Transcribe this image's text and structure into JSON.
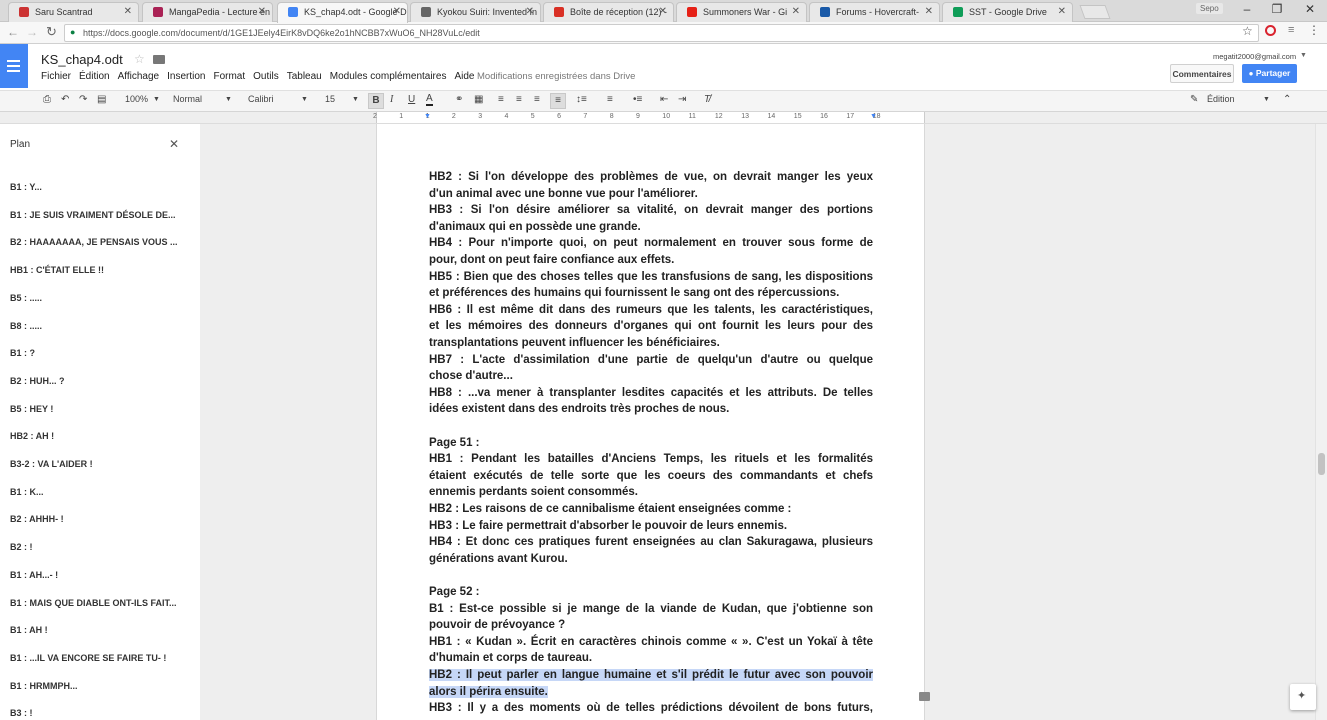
{
  "browser": {
    "tabs": [
      {
        "label": "Saru Scantrad",
        "color": "#cc3333",
        "active": false
      },
      {
        "label": "MangaPedia - Lecture en",
        "color": "#aa2255",
        "active": false
      },
      {
        "label": "KS_chap4.odt - Google D",
        "color": "#4285f4",
        "active": true
      },
      {
        "label": "Kyokou Suiri: Invented In",
        "color": "#666666",
        "active": false
      },
      {
        "label": "Boîte de réception (12) -",
        "color": "#d93025",
        "active": false
      },
      {
        "label": "Summoners War - Gi",
        "color": "#e62117",
        "active": false
      },
      {
        "label": "Forums - Hovercraft-",
        "color": "#1a5aa8",
        "active": false
      },
      {
        "label": "SST - Google Drive",
        "color": "#0f9d58",
        "active": false
      }
    ],
    "user_label": "Sepo",
    "url": "https://docs.google.com/document/d/1GE1JEely4EirK8vDQ6ke2o1hNCBB7xWuO6_NH28VuLc/edit"
  },
  "docs": {
    "title": "KS_chap4.odt",
    "menu": [
      "Fichier",
      "Édition",
      "Affichage",
      "Insertion",
      "Format",
      "Outils",
      "Tableau",
      "Modules complémentaires",
      "Aide"
    ],
    "save_status": "Modifications enregistrées dans Drive",
    "account_email": "megatit2000@gmail.com",
    "comments_label": "Commentaires",
    "share_label": "Partager",
    "accent": "#4285f4",
    "toolbar": {
      "zoom": "100%",
      "style": "Normal",
      "font": "Calibri",
      "size": "15",
      "mode": "Édition"
    },
    "ruler": [
      "2",
      "1",
      "1",
      "2",
      "3",
      "4",
      "5",
      "6",
      "7",
      "8",
      "9",
      "10",
      "11",
      "12",
      "13",
      "14",
      "15",
      "16",
      "17",
      "18"
    ]
  },
  "outline": {
    "title": "Plan",
    "items": [
      "B1 : Y...",
      "B1 : JE SUIS VRAIMENT DÉSOLE DE...",
      "B2 : HAAAAAAA, JE PENSAIS VOUS ...",
      "HB1 : C'ÉTAIT ELLE !!",
      "B5 : .....",
      "B8 : .....",
      "B1 : ?",
      "B2 : HUH... ?",
      "B5 : HEY !",
      "HB2 : AH !",
      "B3-2 : VA L'AIDER !",
      "B1 : K...",
      "B2 : AHHH- !",
      "B2 : !",
      "B1 : AH...- !",
      "B1 : MAIS QUE DIABLE ONT-ILS FAIT...",
      "B1 : AH !",
      "B1 : ...IL VA ENCORE SE FAIRE TU- !",
      "B1 : HRMMPH...",
      "B3 : !"
    ]
  },
  "document_lines": [
    {
      "text": "HB2 : Si l'on développe des problèmes de vue, on devrait manger les yeux",
      "just": true
    },
    {
      "text": "d'un animal avec une bonne vue pour l'améliorer.",
      "just": false
    },
    {
      "text": "HB3 : Si l'on désire améliorer sa vitalité, on devrait manger des portions",
      "just": true
    },
    {
      "text": "d'animaux qui en possède une grande.",
      "just": false
    },
    {
      "text": "HB4 : Pour n'importe quoi, on peut normalement en trouver sous forme de",
      "just": true
    },
    {
      "text": "pour, dont on peut faire confiance aux effets.",
      "just": false
    },
    {
      "text": "HB5 : Bien que des choses telles que les transfusions de sang, les dispositions",
      "just": true
    },
    {
      "text": "et préférences des humains qui fournissent le sang ont des répercussions.",
      "just": false
    },
    {
      "text": "HB6 : Il est même dit dans des rumeurs que les talents, les caractéristiques,",
      "just": true
    },
    {
      "text": "et les mémoires des donneurs d'organes qui ont fournit les leurs pour des",
      "just": true
    },
    {
      "text": "transplantations peuvent influencer les bénéficiaires.",
      "just": false
    },
    {
      "text": "HB7 : L'acte d'assimilation d'une partie de quelqu'un d'autre ou quelque",
      "just": true
    },
    {
      "text": "chose d'autre...",
      "just": false
    },
    {
      "text": "HB8 : ...va mener à transplanter lesdites capacités et les attributs. De telles",
      "just": true
    },
    {
      "text": "idées existent dans des endroits très proches de nous.",
      "just": false
    },
    {
      "text": "",
      "just": false
    },
    {
      "text": "Page 51 :",
      "just": false
    },
    {
      "text": "HB1 : Pendant les batailles d'Anciens Temps, les rituels et les formalités",
      "just": true
    },
    {
      "text": "étaient exécutés de telle sorte que les coeurs des commandants et chefs",
      "just": true
    },
    {
      "text": "ennemis perdants soient consommés.",
      "just": false
    },
    {
      "text": "HB2 : Les raisons de ce cannibalisme étaient enseignées comme :",
      "just": false
    },
    {
      "text": "HB3 : Le faire permettrait d'absorber le pouvoir de leurs ennemis.",
      "just": false
    },
    {
      "text": "HB4 : Et donc ces pratiques furent enseignées au clan Sakuragawa, plusieurs",
      "just": true
    },
    {
      "text": "générations avant Kurou.",
      "just": false
    },
    {
      "text": "",
      "just": false
    },
    {
      "text": "Page 52 :",
      "just": false
    },
    {
      "text": "B1 : Est-ce possible si je mange de la viande de Kudan, que j'obtienne son",
      "just": true
    },
    {
      "text": "pouvoir de prévoyance ?",
      "just": false
    },
    {
      "text": "HB1 : « Kudan ». Écrit en caractères chinois comme « ». C'est un Yokaï à tête",
      "just": true
    },
    {
      "text": "d'humain et corps de taureau.",
      "just": false
    },
    {
      "text": "HB2 : Il peut parler en langue humaine et s'il prédit le futur avec son pouvoir",
      "just": true,
      "selected": true
    },
    {
      "text": "alors il périra ensuite.",
      "just": false,
      "selected": true
    },
    {
      "text": "HB3 : Il y a des moments où de telles prédictions dévoilent de bons futurs,",
      "just": true
    }
  ]
}
